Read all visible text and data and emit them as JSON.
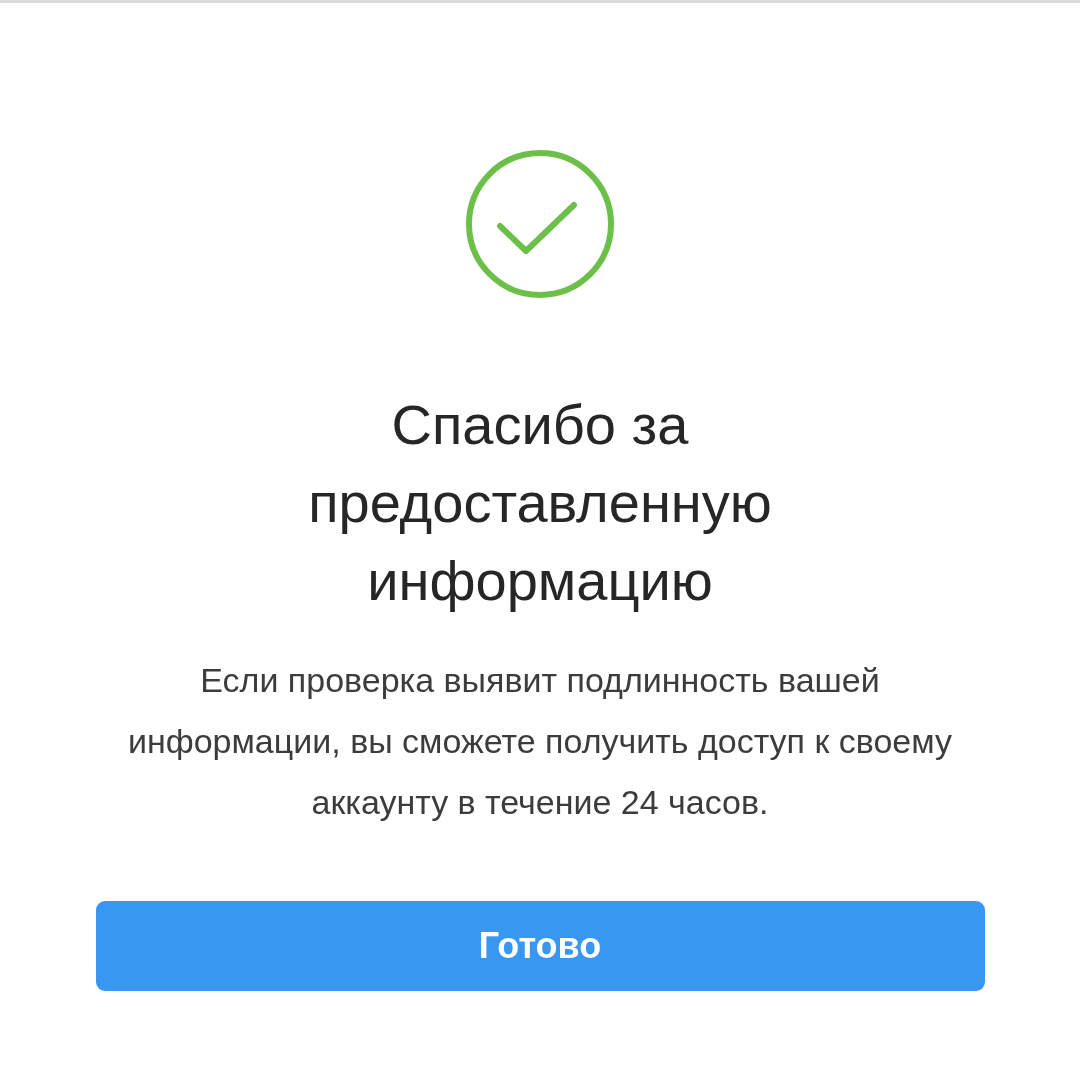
{
  "title": "Спасибо за предоставленную информацию",
  "message": "Если проверка выявит подлинность вашей информации, вы сможете получить доступ к своему аккаунту в течение 24 часов.",
  "button": {
    "label": "Готово"
  }
}
